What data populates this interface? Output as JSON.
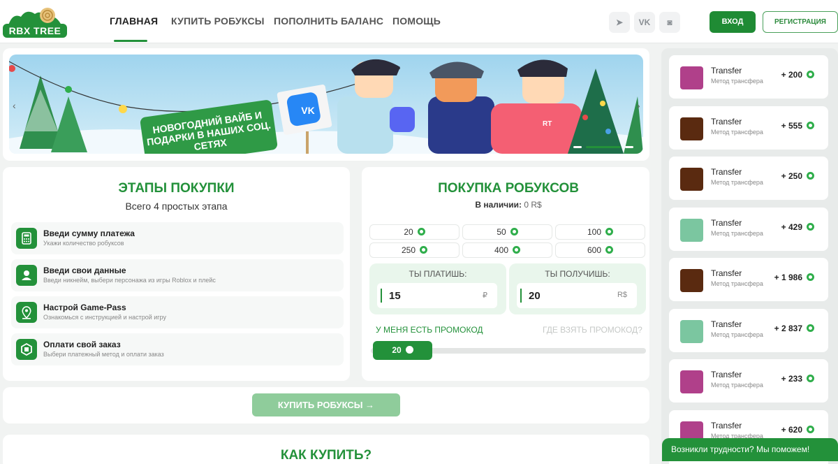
{
  "header": {
    "logo_text": "RBX TREE",
    "nav": [
      {
        "label": "ГЛАВНАЯ",
        "active": true
      },
      {
        "label": "КУПИТЬ РОБУКСЫ",
        "active": false
      },
      {
        "label": "ПОПОЛНИТЬ БАЛАНС",
        "active": false
      },
      {
        "label": "ПОМОЩЬ",
        "active": false
      }
    ],
    "social": [
      {
        "icon": "telegram-icon",
        "glyph": "➤"
      },
      {
        "icon": "vk-icon",
        "glyph": "VK"
      },
      {
        "icon": "discord-icon",
        "glyph": "◙"
      }
    ],
    "login_label": "ВХОД",
    "register_label": "РЕГИСТРАЦИЯ"
  },
  "banner": {
    "promo_text": "НОВОГОДНИЙ ВАЙБ И ПОДАРКИ В НАШИХ СОЦ. СЕТЯХ",
    "sign_text": "VK",
    "badge_text": "RT",
    "prev_glyph": "‹",
    "next_glyph": "›"
  },
  "steps": {
    "title": "ЭТАПЫ ПОКУПКИ",
    "subtitle": "Всего 4 простых этапа",
    "items": [
      {
        "icon": "calculator-icon",
        "title": "Введи сумму платежа",
        "subtitle": "Укажи количество робуксов"
      },
      {
        "icon": "user-icon",
        "title": "Введи свои данные",
        "subtitle": "Введи никнейм, выбери персонажа из игры Roblox и плейс"
      },
      {
        "icon": "location-icon",
        "title": "Настрой Game-Pass",
        "subtitle": "Ознакомься с инструкцией и настрой игру"
      },
      {
        "icon": "robux-icon",
        "title": "Оплати свой заказ",
        "subtitle": "Выбери платежный метод и оплати заказ"
      }
    ]
  },
  "purchase": {
    "title": "ПОКУПКА РОБУКСОВ",
    "stock_label": "В наличии:",
    "stock_value": "0 R$",
    "amounts": [
      "20",
      "50",
      "100",
      "250",
      "400",
      "600"
    ],
    "pay_label": "ТЫ ПЛАТИШЬ:",
    "pay_value": "15",
    "pay_currency": "₽",
    "get_label": "ТЫ ПОЛУЧИШЬ:",
    "get_value": "20",
    "get_currency": "R$",
    "promo_have": "У МЕНЯ ЕСТЬ ПРОМОКОД",
    "promo_where": "ГДЕ ВЗЯТЬ ПРОМОКОД?",
    "slider_value": "20"
  },
  "buy_button": "КУПИТЬ РОБУКСЫ →",
  "how_title": "КАК КУПИТЬ?",
  "transactions": [
    {
      "title": "Transfer",
      "method": "Метод трансфера",
      "amount": "+ 200",
      "thumb": "#b0408a"
    },
    {
      "title": "Transfer",
      "method": "Метод трансфера",
      "amount": "+ 555",
      "thumb": "#5a2a10"
    },
    {
      "title": "Transfer",
      "method": "Метод трансфера",
      "amount": "+ 250",
      "thumb": "#5a2a10"
    },
    {
      "title": "Transfer",
      "method": "Метод трансфера",
      "amount": "+ 429",
      "thumb": "#7bc6a0"
    },
    {
      "title": "Transfer",
      "method": "Метод трансфера",
      "amount": "+ 1 986",
      "thumb": "#5a2a10"
    },
    {
      "title": "Transfer",
      "method": "Метод трансфера",
      "amount": "+ 2 837",
      "thumb": "#7bc6a0"
    },
    {
      "title": "Transfer",
      "method": "Метод трансфера",
      "amount": "+ 233",
      "thumb": "#b0408a"
    },
    {
      "title": "Transfer",
      "method": "Метод трансфера",
      "amount": "+ 620",
      "thumb": "#b0408a"
    }
  ],
  "help_text": "Возникли трудности? Мы поможем!",
  "colors": {
    "accent": "#23913a",
    "light_accent": "#e9f6ec"
  }
}
